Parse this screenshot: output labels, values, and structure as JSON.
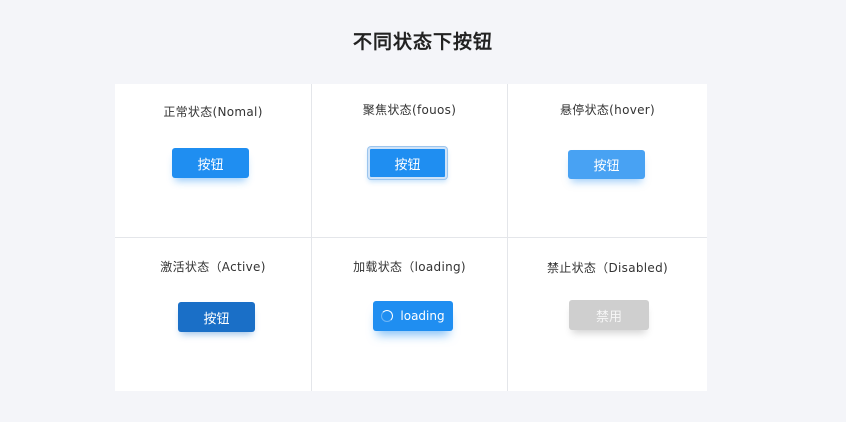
{
  "title": "不同状态下按钮",
  "states": [
    {
      "label": "正常状态(Nomal)",
      "button": "按钮"
    },
    {
      "label": "聚焦状态(fouos)",
      "button": "按钮"
    },
    {
      "label": "悬停状态(hover)",
      "button": "按钮"
    },
    {
      "label": "激活状态（Active)",
      "button": "按钮"
    },
    {
      "label": "加载状态（loading)",
      "button": "loading"
    },
    {
      "label": "禁止状态（Disabled)",
      "button": "禁用"
    }
  ],
  "icons": {
    "loading": "spinner-icon"
  },
  "colors": {
    "primary": "#1f8ef1",
    "hover": "#48a2f3",
    "active": "#1a6fc7",
    "disabled": "#cfcfcf",
    "focus_ring": "#cfe3f8"
  }
}
